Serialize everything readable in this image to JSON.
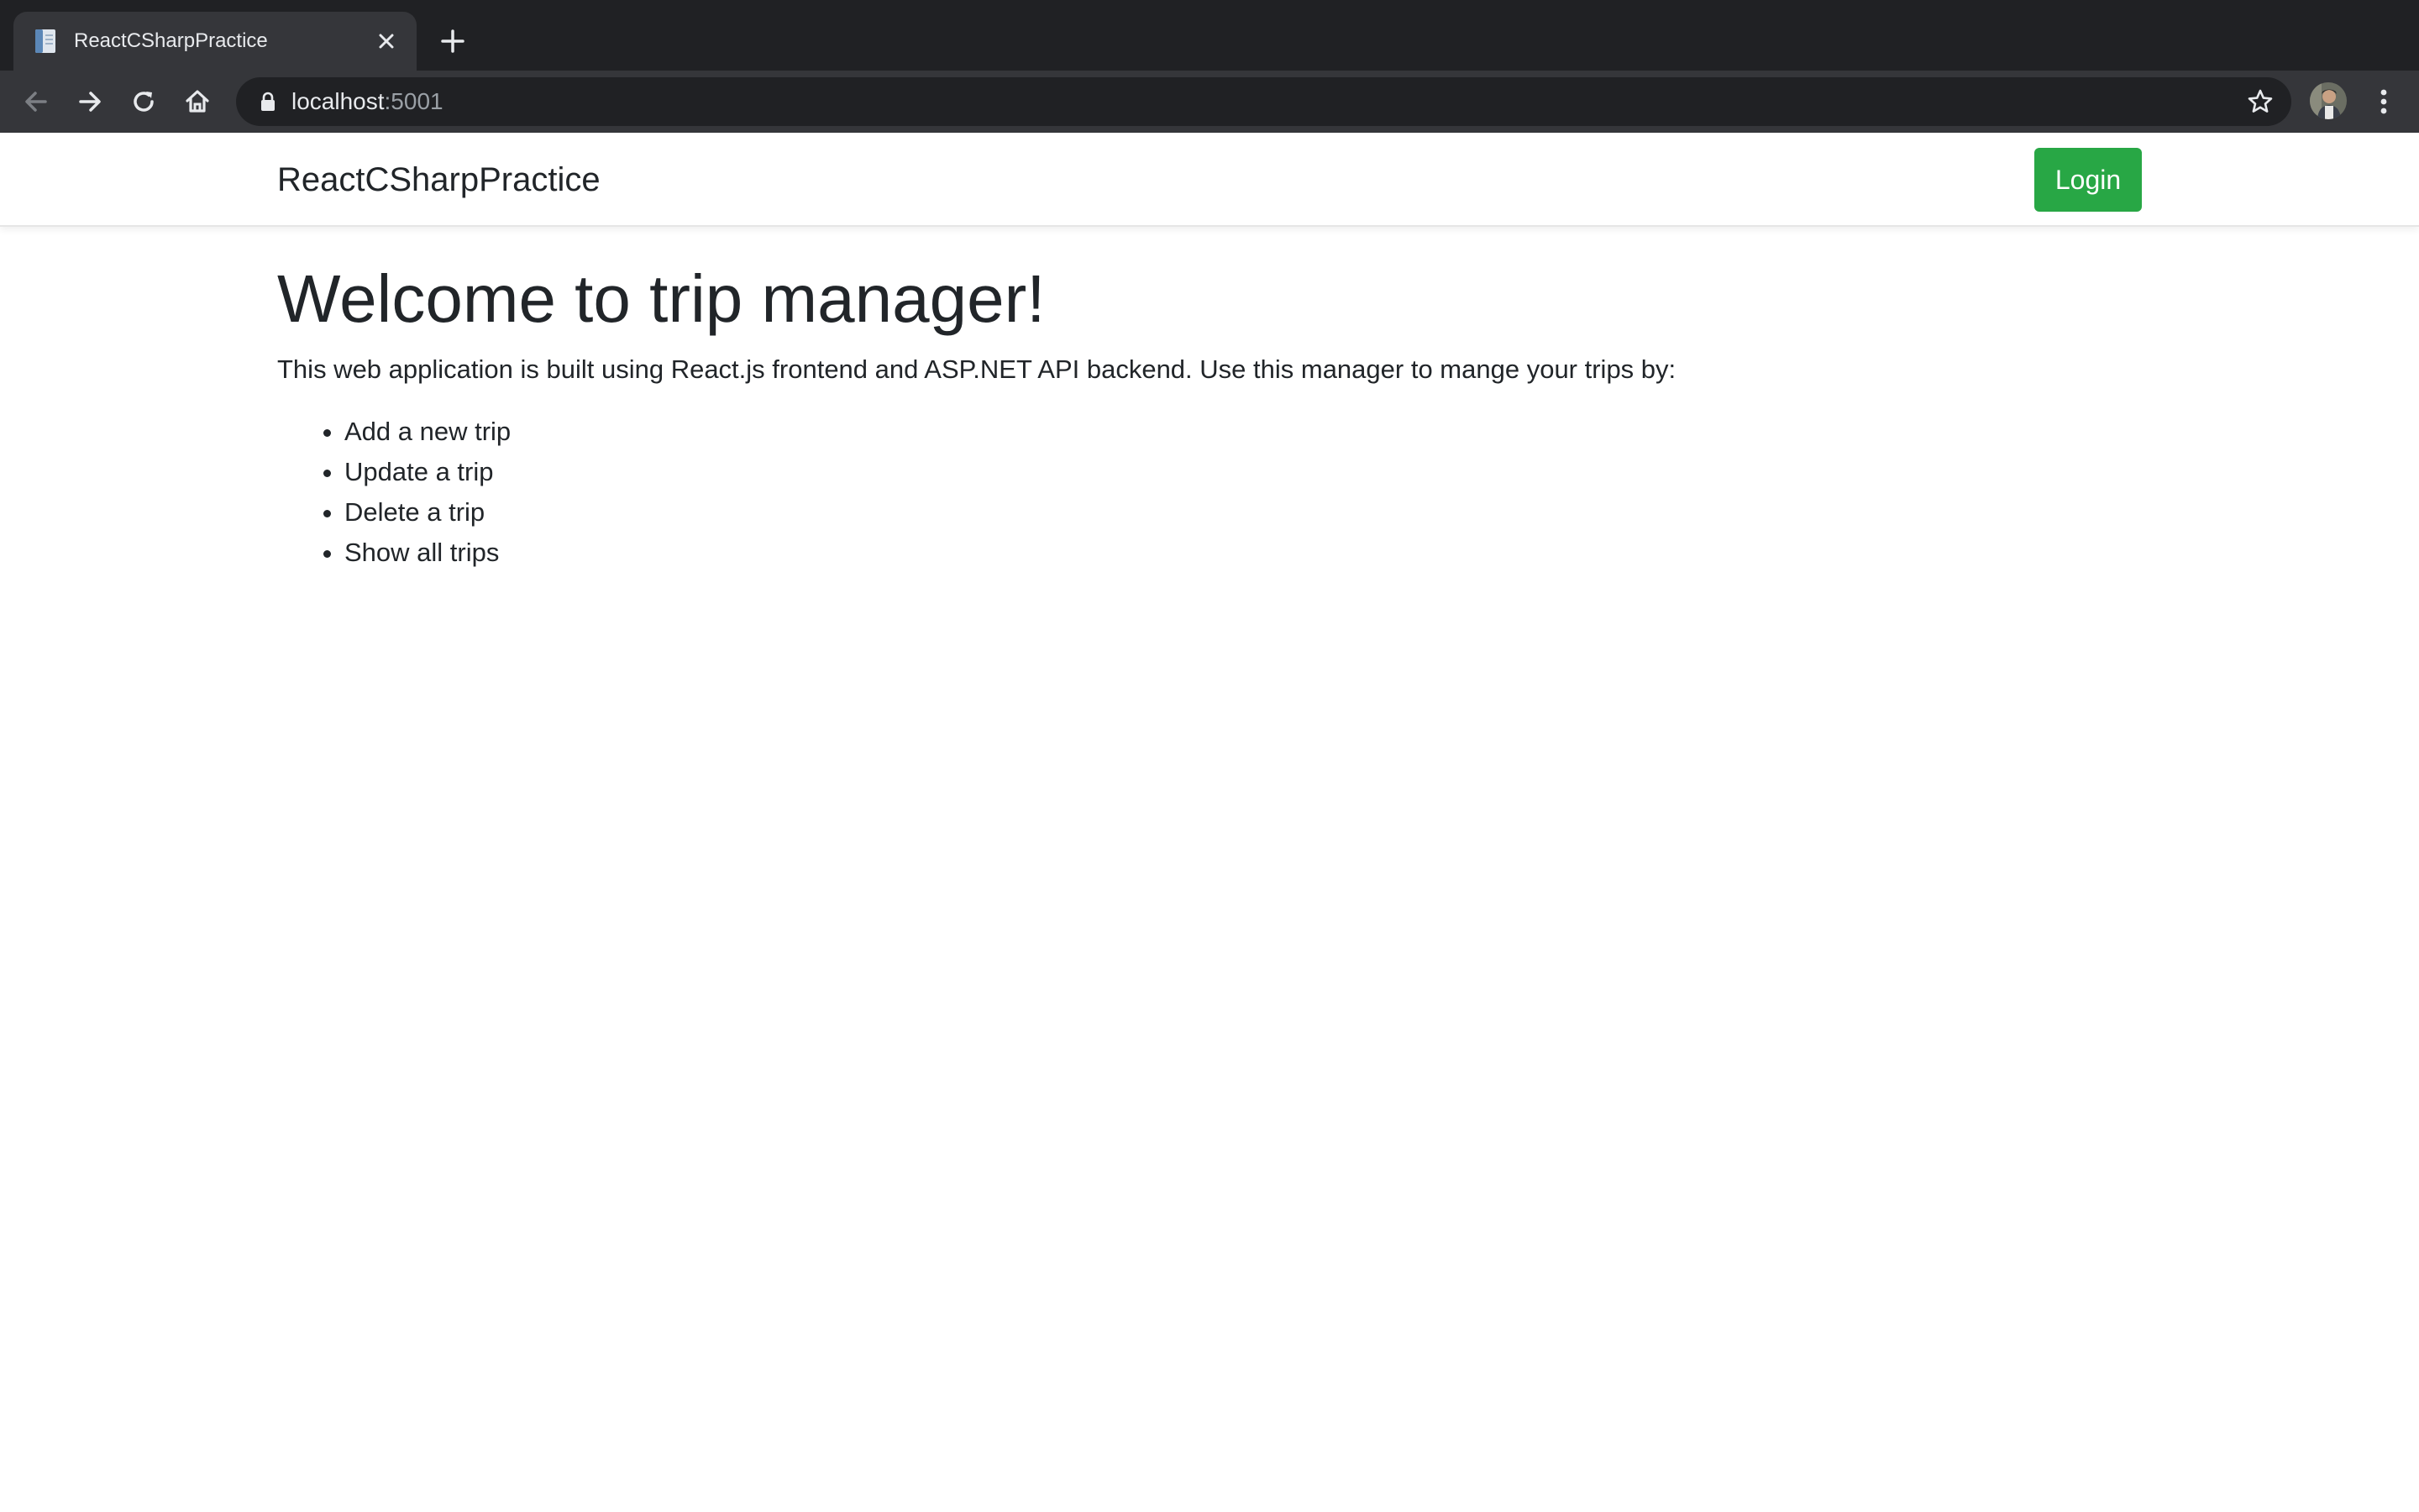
{
  "browser": {
    "tab": {
      "title": "ReactCSharpPractice",
      "favicon": "document-favicon-icon",
      "close_icon": "close-icon"
    },
    "new_tab_icon": "plus-icon",
    "toolbar": {
      "back_icon": "arrow-left-icon",
      "forward_icon": "arrow-right-icon",
      "reload_icon": "reload-icon",
      "home_icon": "home-icon"
    },
    "address_bar": {
      "host": "localhost",
      "port": ":5001",
      "lock_icon": "lock-icon",
      "bookmark_icon": "star-icon"
    },
    "profile_icon": "avatar",
    "menu_icon": "kebab-menu-icon"
  },
  "navbar": {
    "brand": "ReactCSharpPractice",
    "login_label": "Login"
  },
  "main": {
    "heading": "Welcome to trip manager!",
    "intro": "This web application is built using React.js frontend and ASP.NET API backend. Use this manager to mange your trips by:",
    "features": [
      "Add a new trip",
      "Update a trip",
      "Delete a trip",
      "Show all trips"
    ]
  },
  "colors": {
    "chrome_dark": "#202124",
    "chrome_toolbar": "#35363a",
    "login_button": "#28a745",
    "text": "#212529"
  }
}
